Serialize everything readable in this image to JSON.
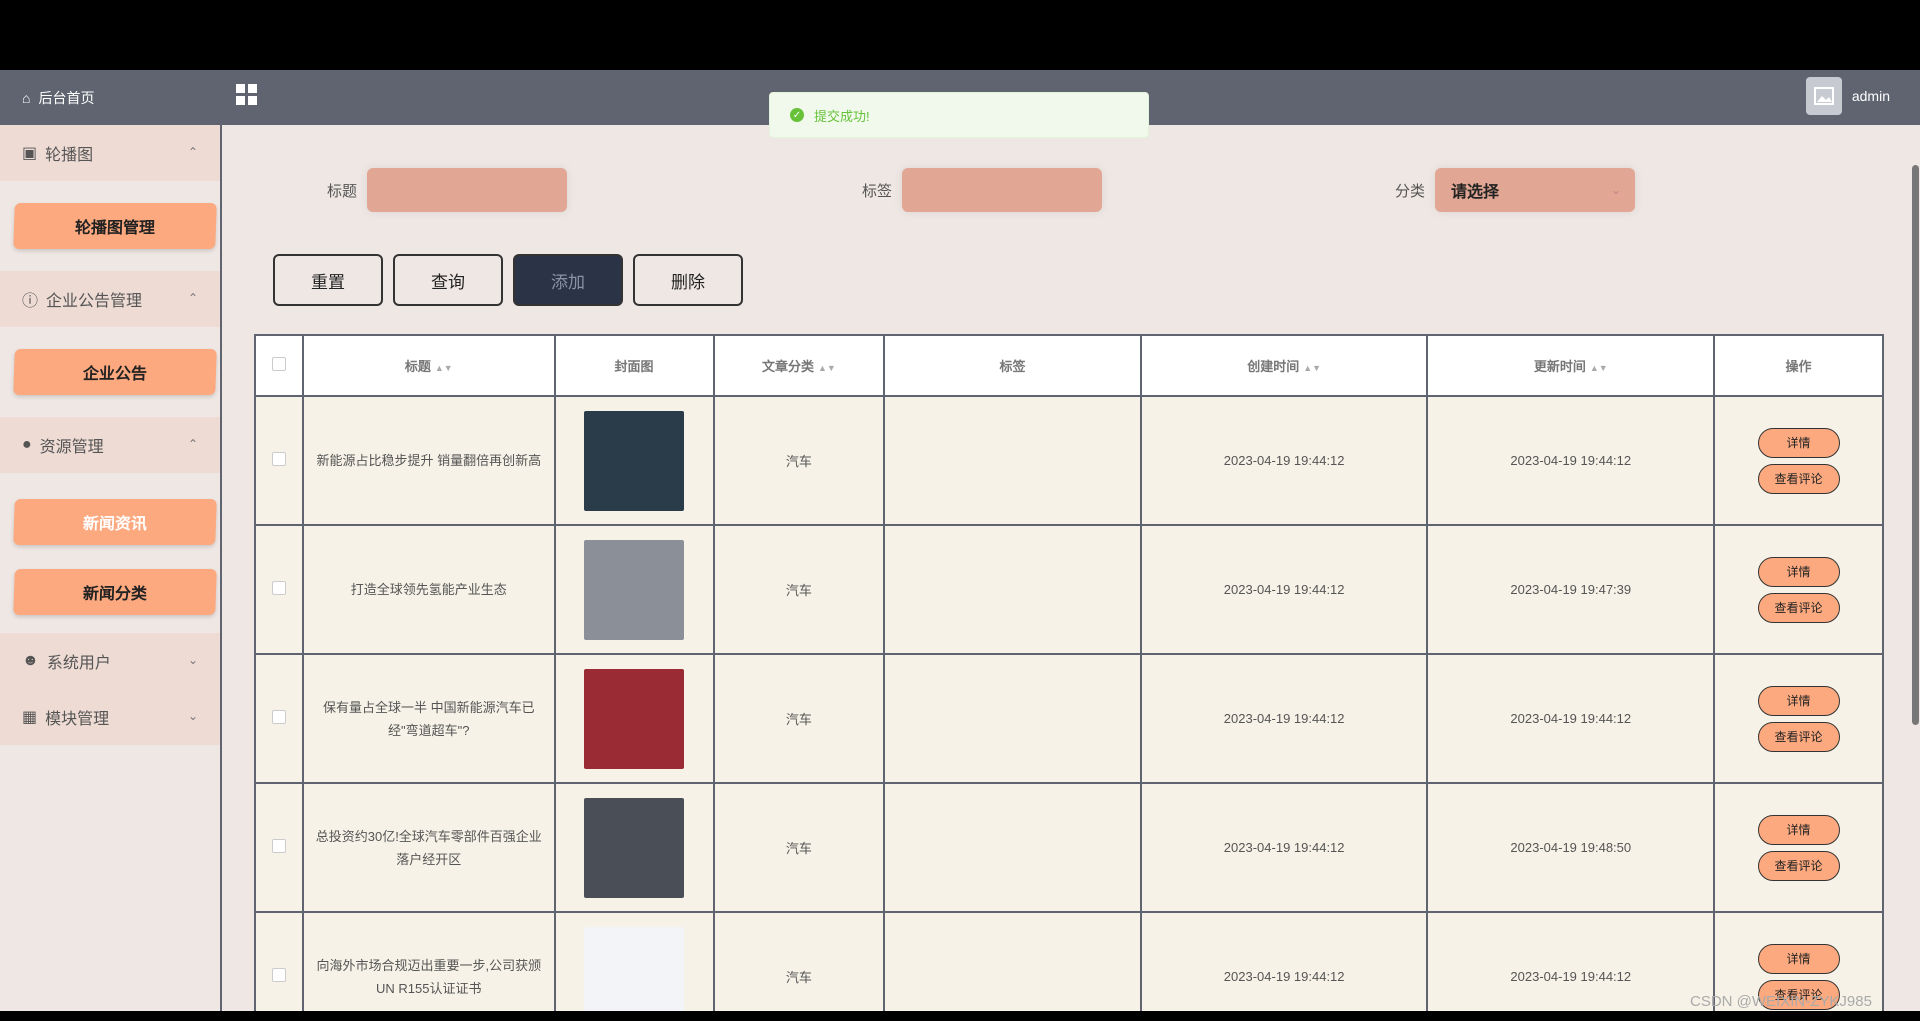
{
  "header": {
    "home_label": "后台首页",
    "site_title": "",
    "username": "admin"
  },
  "toast": {
    "message": "提交成功!"
  },
  "sidebar": {
    "groups": [
      {
        "label": "轮播图",
        "items": [
          "轮播图管理"
        ]
      },
      {
        "label": "企业公告管理",
        "items": [
          "企业公告"
        ]
      },
      {
        "label": "资源管理",
        "items": [
          "新闻资讯",
          "新闻分类"
        ]
      },
      {
        "label": "系统用户",
        "items": []
      },
      {
        "label": "模块管理",
        "items": []
      }
    ]
  },
  "search": {
    "title_label": "标题",
    "tag_label": "标签",
    "category_label": "分类",
    "category_placeholder": "请选择"
  },
  "buttons": {
    "reset": "重置",
    "query": "查询",
    "add": "添加",
    "delete": "删除"
  },
  "table": {
    "headers": [
      "标题",
      "封面图",
      "文章分类",
      "标签",
      "创建时间",
      "更新时间",
      "操作"
    ],
    "rows": [
      {
        "title": "新能源占比稳步提升 销量翻倍再创新高",
        "category": "汽车",
        "tag": "",
        "created": "2023-04-19 19:44:12",
        "updated": "2023-04-19 19:44:12",
        "cover_color": "#2a3b4a"
      },
      {
        "title": "打造全球领先氢能产业生态",
        "category": "汽车",
        "tag": "",
        "created": "2023-04-19 19:44:12",
        "updated": "2023-04-19 19:47:39",
        "cover_color": "#8a8f98"
      },
      {
        "title": "保有量占全球一半 中国新能源汽车已经\"弯道超车\"?",
        "category": "汽车",
        "tag": "",
        "created": "2023-04-19 19:44:12",
        "updated": "2023-04-19 19:44:12",
        "cover_color": "#9a2a34"
      },
      {
        "title": "总投资约30亿!全球汽车零部件百强企业落户经开区",
        "category": "汽车",
        "tag": "",
        "created": "2023-04-19 19:44:12",
        "updated": "2023-04-19 19:48:50",
        "cover_color": "#4a4f57"
      },
      {
        "title": "向海外市场合规迈出重要一步,公司获颁UN R155认证证书",
        "category": "汽车",
        "tag": "",
        "created": "2023-04-19 19:44:12",
        "updated": "2023-04-19 19:44:12",
        "cover_color": "#f3f4f7"
      }
    ],
    "op_detail": "详情",
    "op_comments": "查看评论"
  },
  "watermark": "CSDN @WEIXIN-ZYKJ985"
}
